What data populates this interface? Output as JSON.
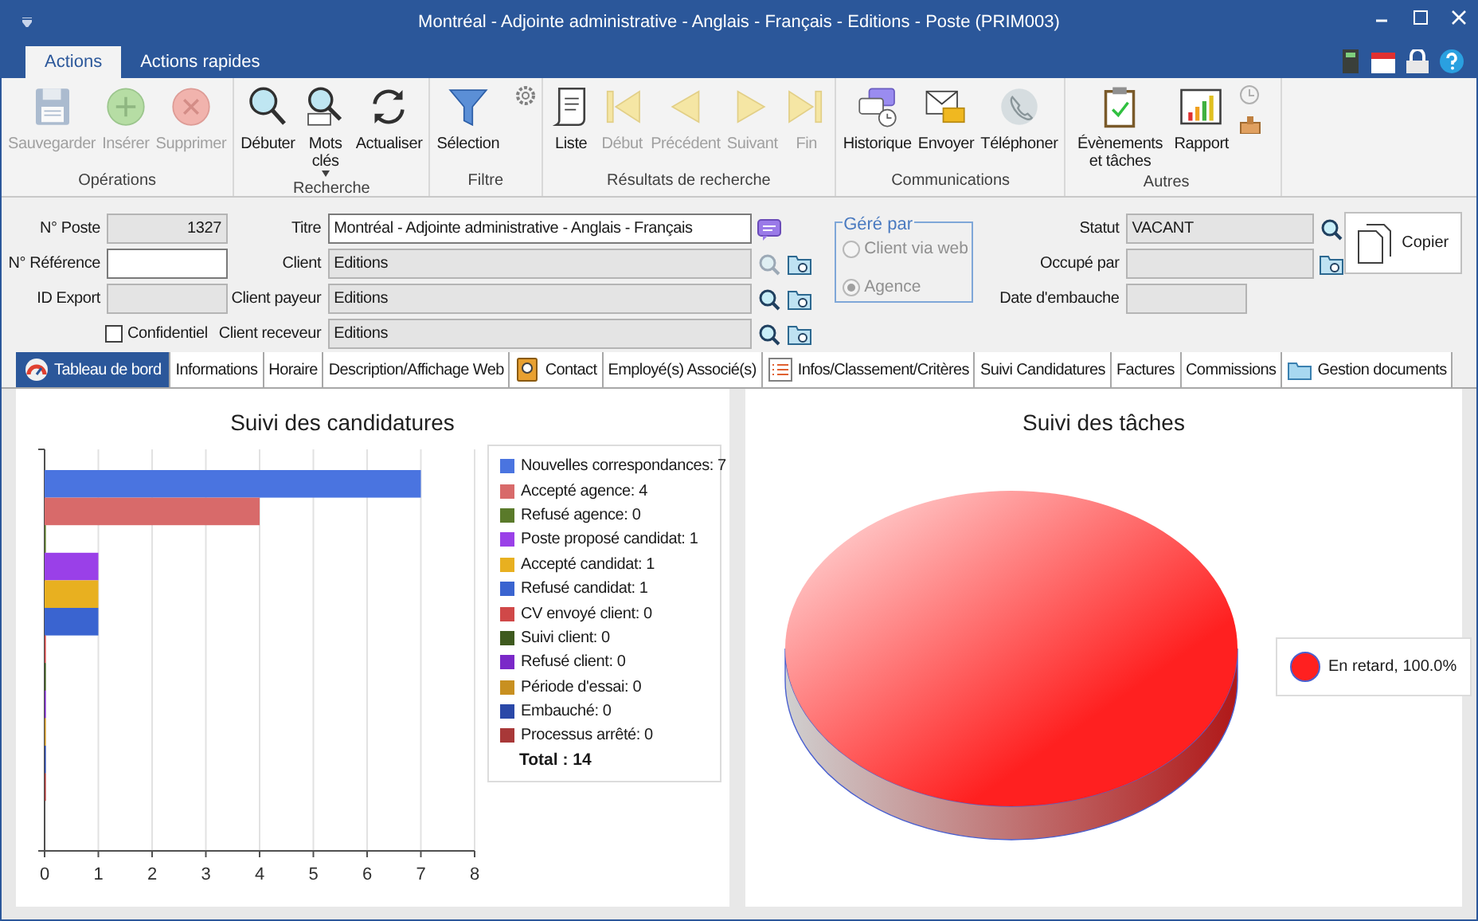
{
  "window": {
    "title": "Montréal - Adjointe administrative - Anglais - Français - Editions - Poste (PRIM003)"
  },
  "ribbon_tabs": [
    {
      "label": "Actions",
      "selected": true
    },
    {
      "label": "Actions rapides",
      "selected": false
    }
  ],
  "ribbon_groups": [
    {
      "label": "Opérations",
      "buttons": [
        {
          "kind": "save",
          "label": "Sauvegarder",
          "disabled": true
        },
        {
          "kind": "add",
          "label": "Insérer",
          "disabled": true
        },
        {
          "kind": "delete",
          "label": "Supprimer",
          "disabled": true
        }
      ]
    },
    {
      "label": "Recherche",
      "buttons": [
        {
          "kind": "search",
          "label": "Débuter",
          "disabled": false
        },
        {
          "kind": "keywords",
          "label": "Mots clés",
          "disabled": false
        },
        {
          "kind": "refresh",
          "label": "Actualiser",
          "disabled": false
        }
      ]
    },
    {
      "label": "Filtre",
      "buttons": [
        {
          "kind": "filter",
          "label": "Sélection",
          "disabled": false
        }
      ]
    },
    {
      "label": "Résultats de recherche",
      "buttons": [
        {
          "kind": "list",
          "label": "Liste",
          "disabled": false
        },
        {
          "kind": "first",
          "label": "Début",
          "disabled": true
        },
        {
          "kind": "prev",
          "label": "Précédent",
          "disabled": true
        },
        {
          "kind": "next",
          "label": "Suivant",
          "disabled": true
        },
        {
          "kind": "last",
          "label": "Fin",
          "disabled": true
        }
      ]
    },
    {
      "label": "Communications",
      "buttons": [
        {
          "kind": "history",
          "label": "Historique",
          "disabled": false
        },
        {
          "kind": "send",
          "label": "Envoyer",
          "disabled": false
        },
        {
          "kind": "phone",
          "label": "Téléphoner",
          "disabled": false
        }
      ]
    },
    {
      "label": "Autres",
      "buttons": [
        {
          "kind": "events",
          "label": "Évènements et tâches",
          "disabled": false
        },
        {
          "kind": "report",
          "label": "Rapport",
          "disabled": false
        }
      ]
    }
  ],
  "form": {
    "left": [
      {
        "label": "N° Poste",
        "value": "1327",
        "disabled": true
      },
      {
        "label": "N° Référence",
        "disabled": false
      },
      {
        "label": "ID Export",
        "disabled": true
      }
    ],
    "confidential": {
      "label": "Confidentiel",
      "checked": false
    },
    "middle": [
      {
        "label": "Titre",
        "value": "Montréal - Adjointe administrative - Anglais - Français",
        "disabled": false,
        "actions": [
          {
            "kind": "comment",
            "disabled": false
          }
        ]
      },
      {
        "label": "Client",
        "value": "Editions",
        "disabled": true,
        "actions": [
          {
            "kind": "search",
            "disabled": true
          },
          {
            "kind": "folder",
            "disabled": false
          }
        ]
      },
      {
        "label": "Client payeur",
        "value": "Editions",
        "disabled": true,
        "actions": [
          {
            "kind": "search",
            "disabled": false
          },
          {
            "kind": "folder",
            "disabled": false
          }
        ]
      },
      {
        "label": "Client receveur",
        "value": "Editions",
        "disabled": true,
        "actions": [
          {
            "kind": "search",
            "disabled": false
          },
          {
            "kind": "folder",
            "disabled": false
          }
        ]
      }
    ],
    "managed_by": {
      "title": "Géré par",
      "options": [
        {
          "label": "Client via web",
          "selected": false,
          "disabled": true
        },
        {
          "label": "Agence",
          "selected": true,
          "disabled": true
        }
      ]
    },
    "right": [
      {
        "label": "Statut",
        "value": "VACANT",
        "disabled": true,
        "actions": [
          {
            "kind": "search",
            "disabled": false
          }
        ]
      },
      {
        "label": "Occupé par",
        "disabled": true,
        "actions": [
          {
            "kind": "folder",
            "disabled": false
          }
        ]
      },
      {
        "label": "Date d'embauche",
        "disabled": true
      }
    ],
    "copy_button": "Copier"
  },
  "tabs": [
    {
      "label": "Tableau de bord",
      "kind": "dashboard",
      "selected": true
    },
    {
      "label": "Informations",
      "kind": "plain",
      "selected": false
    },
    {
      "label": "Horaire",
      "kind": "plain",
      "selected": false
    },
    {
      "label": "Description/Affichage Web",
      "kind": "plain",
      "selected": false
    },
    {
      "label": "Contact",
      "kind": "contact",
      "selected": false
    },
    {
      "label": "Employé(s) Associé(s)",
      "kind": "plain",
      "selected": false
    },
    {
      "label": "Infos/Classement/Critères",
      "kind": "list",
      "selected": false
    },
    {
      "label": "Suivi Candidatures",
      "kind": "plain",
      "selected": false
    },
    {
      "label": "Factures",
      "kind": "plain",
      "selected": false
    },
    {
      "label": "Commissions",
      "kind": "plain",
      "selected": false
    },
    {
      "label": "Gestion documents",
      "kind": "folder",
      "selected": false
    }
  ],
  "candidates_panel": {
    "chart_data": {
      "type": "bar",
      "orientation": "horizontal",
      "title": "Suivi des candidatures",
      "grid": true,
      "xlim": [
        0,
        8
      ],
      "xticks": [
        0,
        1,
        2,
        3,
        4,
        5,
        6,
        7,
        8
      ],
      "series": [
        {
          "name": "Nouvelles correspondances: 7",
          "color": "#4a74e0",
          "values": [
            7
          ]
        },
        {
          "name": "Accepté agence: 4",
          "color": "#d86a6a",
          "values": [
            4
          ]
        },
        {
          "name": "Refusé agence: 0",
          "color": "#5a7a2a",
          "values": [
            0
          ]
        },
        {
          "name": "Poste proposé candidat: 1",
          "color": "#9a40e8",
          "values": [
            1
          ]
        },
        {
          "name": "Accepté candidat: 1",
          "color": "#e8b020",
          "values": [
            1
          ]
        },
        {
          "name": "Refusé candidat: 1",
          "color": "#3a64d0",
          "values": [
            1
          ]
        },
        {
          "name": "CV envoyé client: 0",
          "color": "#d04848",
          "values": [
            0
          ]
        },
        {
          "name": "Suivi client: 0",
          "color": "#3e5a1e",
          "values": [
            0
          ]
        },
        {
          "name": "Refusé client: 0",
          "color": "#7a28c8",
          "values": [
            0
          ]
        },
        {
          "name": "Période d'essai: 0",
          "color": "#c89020",
          "values": [
            0
          ]
        },
        {
          "name": "Embauché: 0",
          "color": "#2a48a8",
          "values": [
            0
          ]
        },
        {
          "name": "Processus arrêté: 0",
          "color": "#a83838",
          "values": [
            0
          ]
        }
      ]
    },
    "total": "Total : 14"
  },
  "tasks_panel": {
    "chart_data": {
      "type": "pie",
      "title": "Suivi des tâches",
      "series": [
        {
          "name": "En retard, 100.0%",
          "color": "#ff2020",
          "values": [
            100
          ]
        }
      ]
    }
  }
}
